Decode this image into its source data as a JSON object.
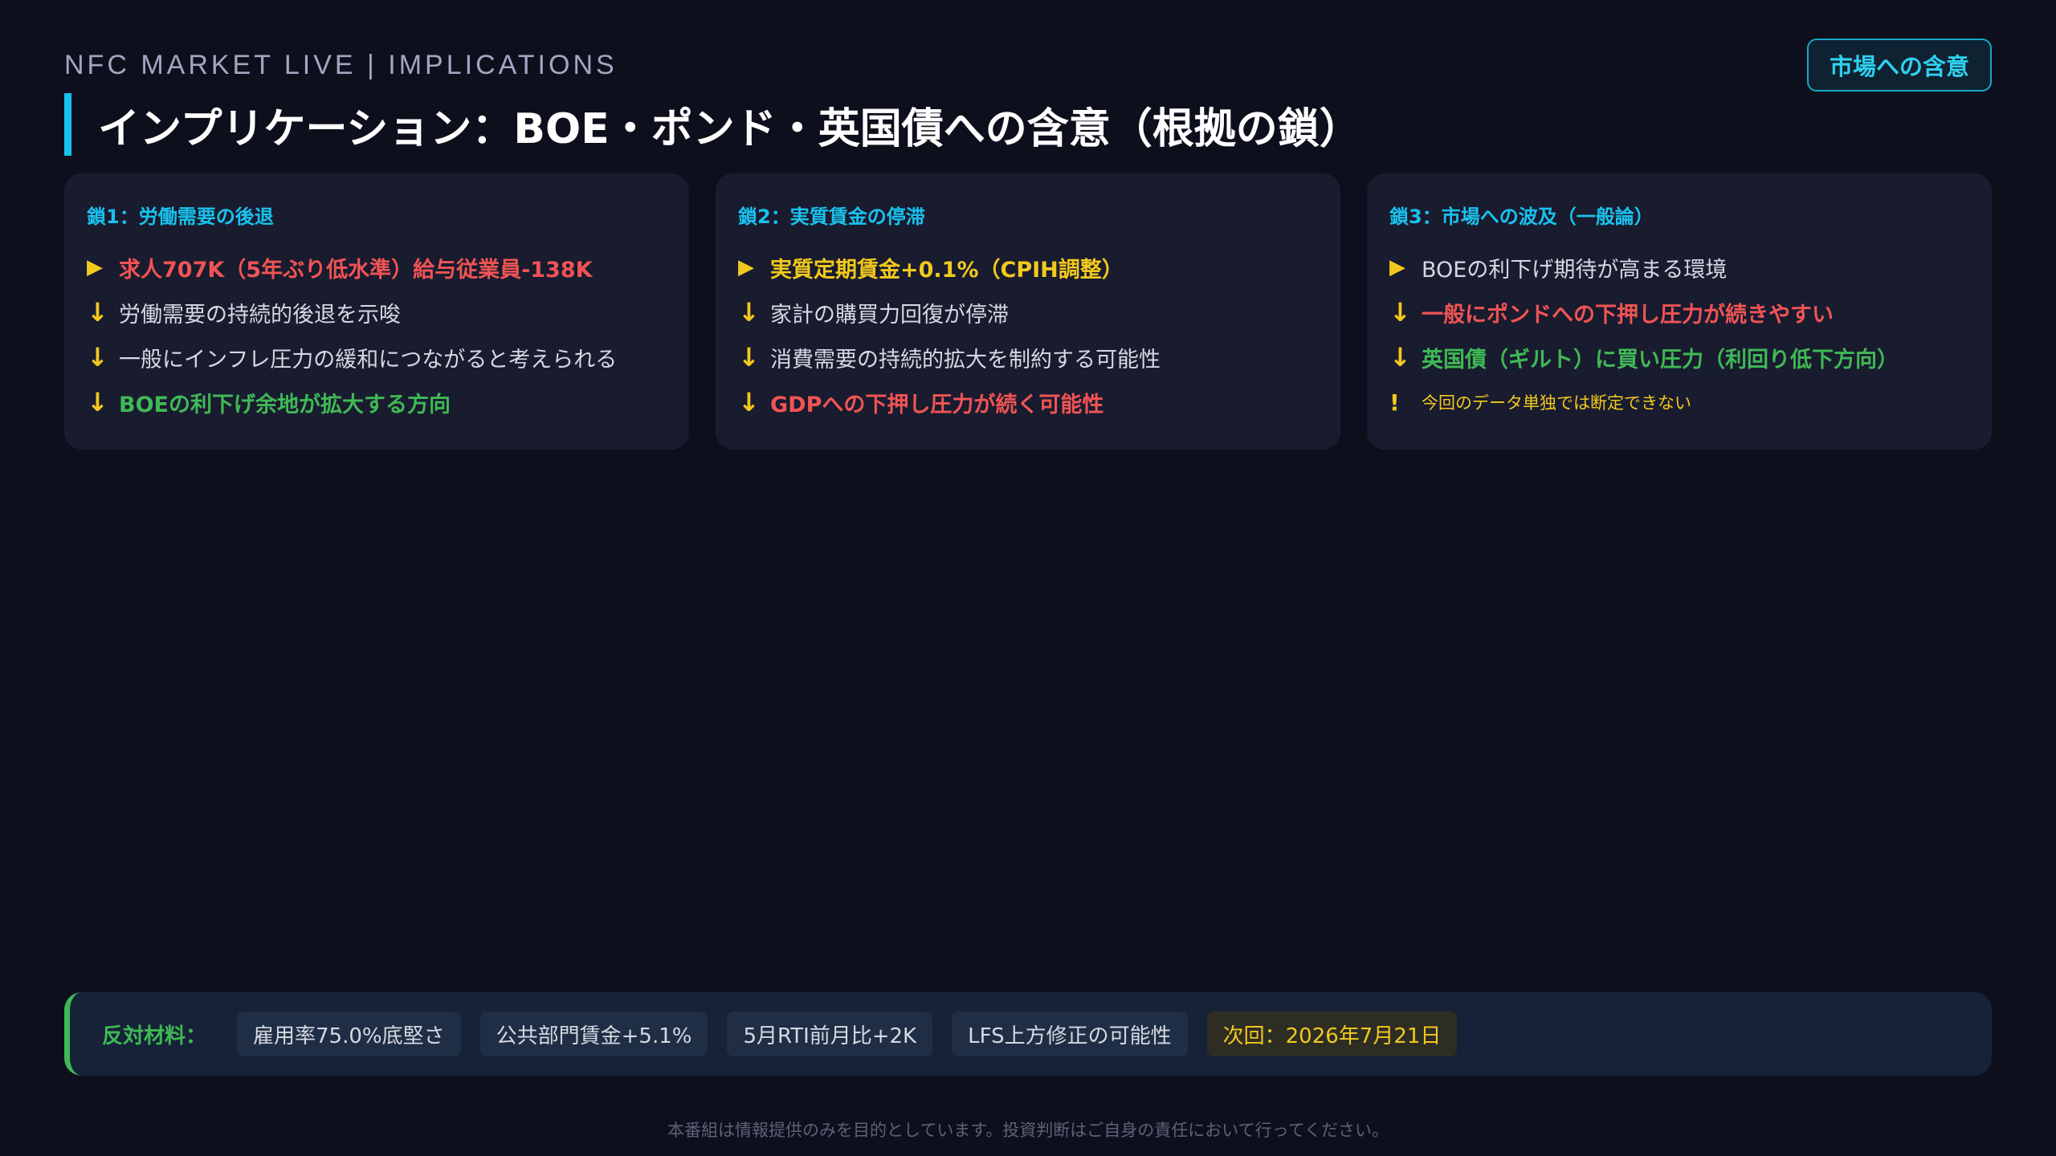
{
  "header": {
    "kicker": "NFC MARKET LIVE | IMPLICATIONS",
    "badge": "市場への含意",
    "title": "インプリケーション：BOE・ポンド・英国債への含意（根拠の鎖）"
  },
  "cards": [
    {
      "heading": "鎖1：労働需要の後退",
      "rows": [
        {
          "marker": "▶",
          "text": "求人707K（5年ぶり低水準）給与従業員-138K",
          "tone": "red"
        },
        {
          "marker": "↓",
          "text": "労働需要の持続的後退を示唆",
          "tone": "white"
        },
        {
          "marker": "↓",
          "text": "一般にインフレ圧力の緩和につながると考えられる",
          "tone": "white"
        },
        {
          "marker": "↓",
          "text": "BOEの利下げ余地が拡大する方向",
          "tone": "green"
        }
      ]
    },
    {
      "heading": "鎖2：実質賃金の停滞",
      "rows": [
        {
          "marker": "▶",
          "text": "実質定期賃金+0.1%（CPIH調整）",
          "tone": "yellow"
        },
        {
          "marker": "↓",
          "text": "家計の購買力回復が停滞",
          "tone": "white"
        },
        {
          "marker": "↓",
          "text": "消費需要の持続的拡大を制約する可能性",
          "tone": "white"
        },
        {
          "marker": "↓",
          "text": "GDPへの下押し圧力が続く可能性",
          "tone": "red"
        }
      ]
    },
    {
      "heading": "鎖3：市場への波及（一般論）",
      "rows": [
        {
          "marker": "▶",
          "text": "BOEの利下げ期待が高まる環境",
          "tone": "white"
        },
        {
          "marker": "↓",
          "text": "一般にポンドへの下押し圧力が続きやすい",
          "tone": "red"
        },
        {
          "marker": "↓",
          "text": "英国債（ギルト）に買い圧力（利回り低下方向）",
          "tone": "green"
        },
        {
          "marker": "!",
          "text": "今回のデータ単独では断定できない",
          "tone": "note"
        }
      ]
    }
  ],
  "counter": {
    "label": "反対材料：",
    "chips": [
      "雇用率75.0%底堅さ",
      "公共部門賃金+5.1%",
      "5月RTI前月比+2K",
      "LFS上方修正の可能性"
    ],
    "next": "次回：2026年7月21日"
  },
  "footer": "本番組は情報提供のみを目的としています。投資判断はご自身の責任において行ってください。",
  "colors": {
    "background": "#0e0f1c",
    "card": "#191b2f",
    "accent_cyan": "#19c2ee",
    "red": "#f05454",
    "green": "#3fb955",
    "yellow": "#f2c91d"
  }
}
